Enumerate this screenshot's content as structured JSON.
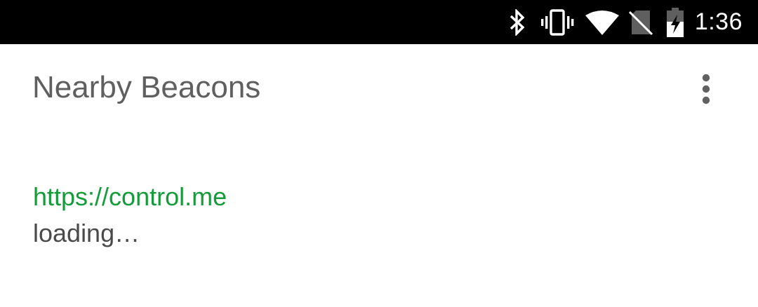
{
  "status_bar": {
    "time": "1:36",
    "icons": [
      "bluetooth-icon",
      "vibrate-icon",
      "wifi-icon",
      "no-sim-icon",
      "battery-charging-icon"
    ]
  },
  "app_bar": {
    "title": "Nearby Beacons",
    "menu_icon": "overflow-menu-icon"
  },
  "beacons": [
    {
      "url": "https://control.me",
      "status": "loading…"
    }
  ],
  "colors": {
    "status_bar_bg": "#000000",
    "title_text": "#5f5f5f",
    "url_text": "#159b3a",
    "body_text": "#4a4a4a"
  }
}
